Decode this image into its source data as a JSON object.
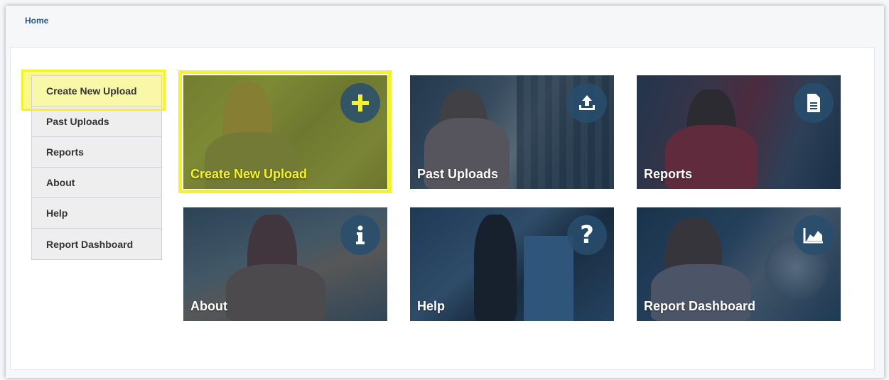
{
  "breadcrumb": {
    "home": "Home"
  },
  "sidebar": {
    "items": [
      {
        "label": "Create New Upload",
        "selected": true
      },
      {
        "label": "Past Uploads"
      },
      {
        "label": "Reports"
      },
      {
        "label": "About"
      },
      {
        "label": "Help"
      },
      {
        "label": "Report Dashboard"
      }
    ]
  },
  "tiles": [
    {
      "label": "Create New Upload",
      "icon": "plus-icon",
      "active": true
    },
    {
      "label": "Past Uploads",
      "icon": "upload-icon"
    },
    {
      "label": "Reports",
      "icon": "document-icon"
    },
    {
      "label": "About",
      "icon": "info-icon"
    },
    {
      "label": "Help",
      "icon": "question-icon"
    },
    {
      "label": "Report Dashboard",
      "icon": "area-chart-icon"
    }
  ],
  "colors": {
    "highlight": "#f4f22b",
    "breadcrumb": "#2a5a8c",
    "icon_circle": "#284e6e"
  }
}
